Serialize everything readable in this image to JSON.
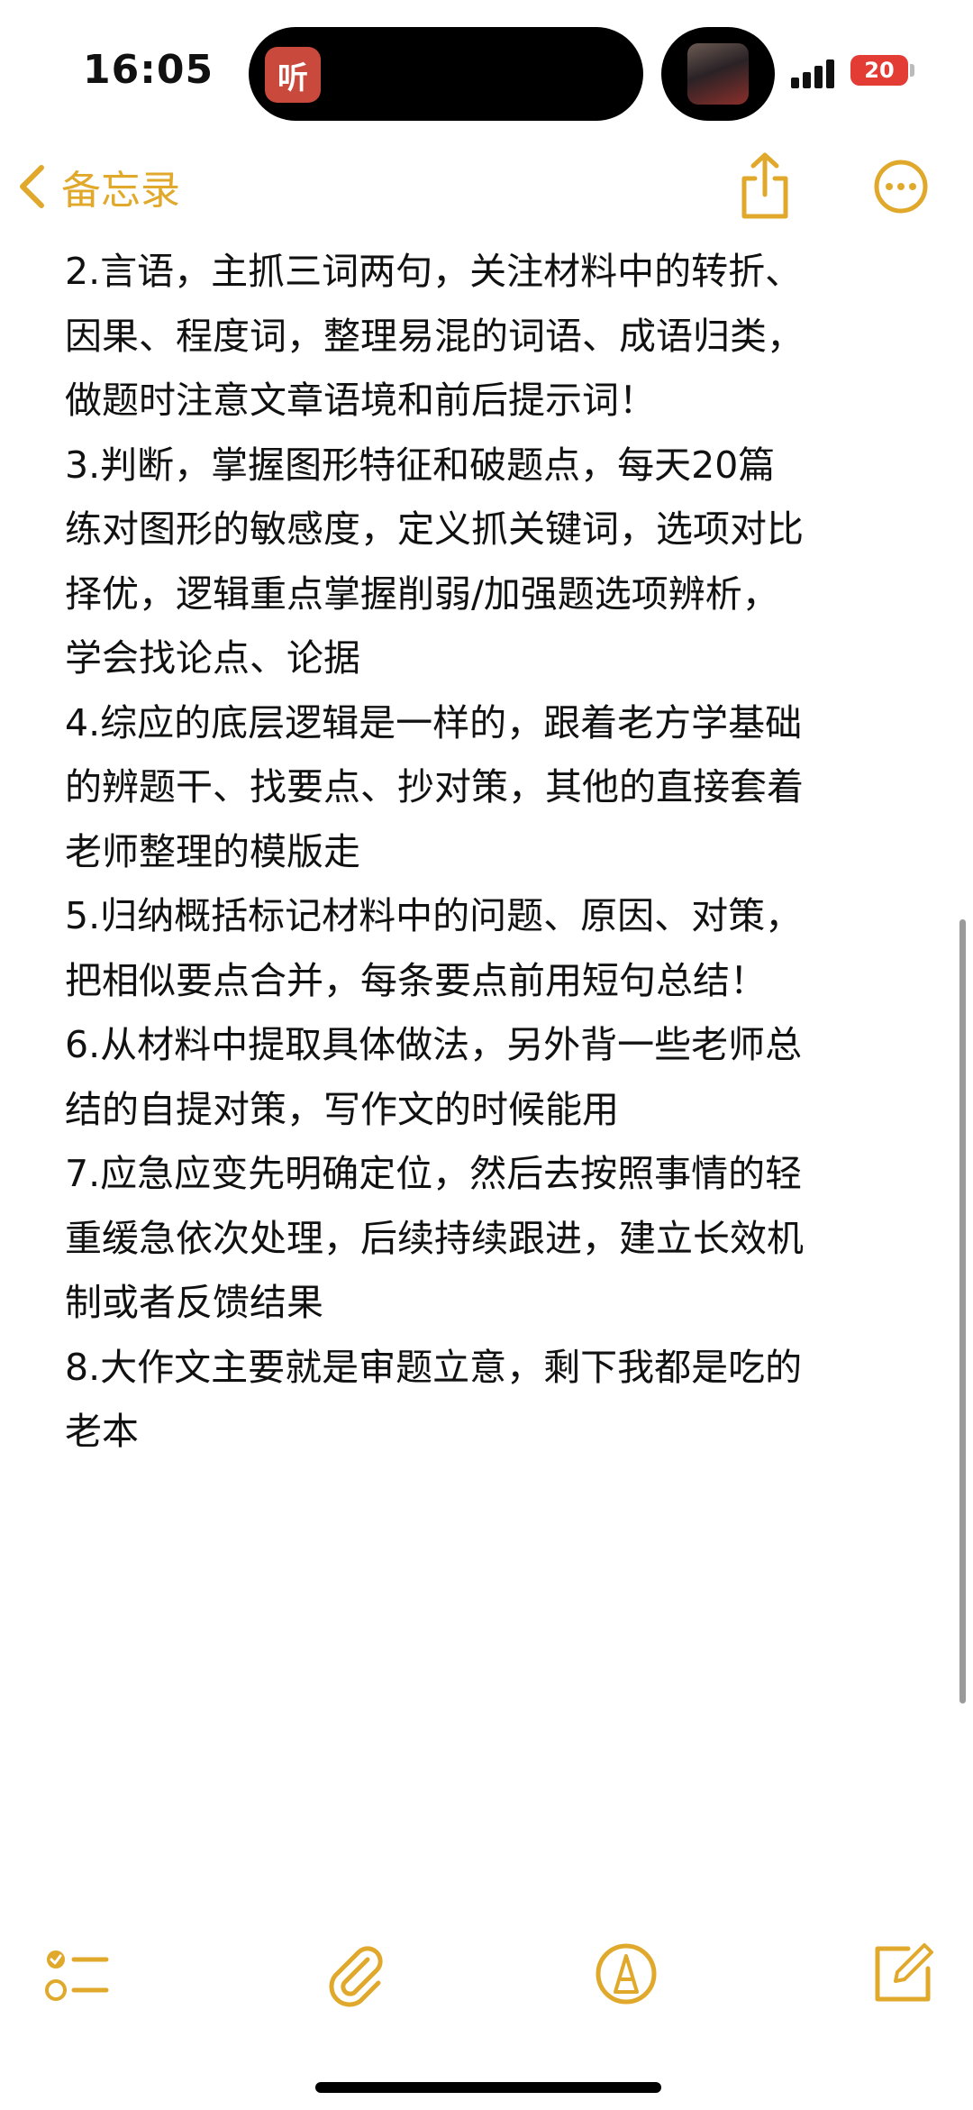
{
  "status_bar": {
    "time": "16:05",
    "island_app_glyph": "听",
    "battery_level": "20",
    "accent_color": "#e23c34"
  },
  "nav": {
    "back_label": "备忘录",
    "back_icon": "chevron-left-icon",
    "share_icon": "share-icon",
    "more_icon": "ellipsis-circle-icon",
    "accent_color": "#e0a92b"
  },
  "note": {
    "lines": [
      "2.言语，主抓三词两句，关注材料中的转折、",
      "因果、程度词，整理易混的词语、成语归类，",
      "做题时注意文章语境和前后提示词！",
      "3.判断，掌握图形特征和破题点，每天20篇",
      "练对图形的敏感度，定义抓关键词，选项对比",
      "择优，逻辑重点掌握削弱/加强题选项辨析，",
      "学会找论点、论据",
      "4.综应的底层逻辑是一样的，跟着老方学基础",
      "的辨题干、找要点、抄对策，其他的直接套着",
      "老师整理的模版走",
      "5.归纳概括标记材料中的问题、原因、对策，",
      "把相似要点合并，每条要点前用短句总结！",
      "6.从材料中提取具体做法，另外背一些老师总",
      "结的自提对策，写作文的时候能用",
      "7.应急应变先明确定位，然后去按照事情的轻",
      "重缓急依次处理，后续持续跟进，建立长效机",
      "制或者反馈结果",
      "8.大作文主要就是审题立意，剩下我都是吃的",
      "老本"
    ]
  },
  "toolbar": {
    "items": [
      {
        "icon": "checklist-icon"
      },
      {
        "icon": "paperclip-icon"
      },
      {
        "icon": "markup-pen-icon"
      },
      {
        "icon": "compose-icon"
      }
    ]
  }
}
